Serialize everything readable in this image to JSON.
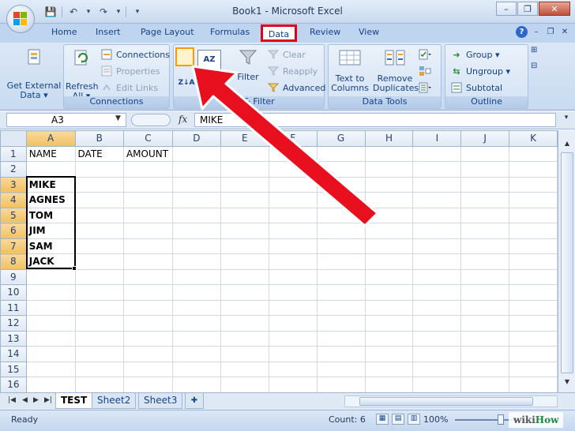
{
  "window": {
    "title": "Book1 - Microsoft Excel",
    "minimize": "–",
    "restore": "❐",
    "close": "✕"
  },
  "qat": {
    "save": "💾",
    "undo": "↶",
    "redo": "↷",
    "more": "▾"
  },
  "tabs": [
    {
      "label": "Home"
    },
    {
      "label": "Insert"
    },
    {
      "label": "Page Layout"
    },
    {
      "label": "Formulas"
    },
    {
      "label": "Data",
      "active": true
    },
    {
      "label": "Review"
    },
    {
      "label": "View"
    }
  ],
  "ribbon": {
    "get_external": {
      "line1": "Get External",
      "line2": "Data ▾"
    },
    "refresh": {
      "line1": "Refresh",
      "line2": "All ▾"
    },
    "connections": "Connections",
    "properties": "Properties",
    "edit_links": "Edit Links",
    "connections_group": "Connections",
    "sort_asc_icon": "A↓Z",
    "sort_desc_icon": "Z↓A",
    "sort_dialog_icon": "AZ",
    "filter": "Filter",
    "clear": "Clear",
    "reapply": "Reapply",
    "advanced": "Advanced",
    "sort_filter_group": "Sort & Filter",
    "text_to_columns": {
      "line1": "Text to",
      "line2": "Columns"
    },
    "remove_duplicates": {
      "line1": "Remove",
      "line2": "Duplicates"
    },
    "data_tools_group": "Data Tools",
    "group": "Group ▾",
    "ungroup": "Ungroup ▾",
    "subtotal": "Subtotal",
    "outline_group": "Outline"
  },
  "formula_bar": {
    "name_box": "A3",
    "fx": "fx",
    "value": "MIKE"
  },
  "grid": {
    "columns": [
      "A",
      "B",
      "C",
      "D",
      "E",
      "F",
      "G",
      "H",
      "I",
      "J",
      "K"
    ],
    "rows": [
      [
        "NAME",
        "DATE",
        "AMOUNT",
        "",
        "",
        "",
        "",
        "",
        "",
        "",
        ""
      ],
      [
        "",
        "",
        "",
        "",
        "",
        "",
        "",
        "",
        "",
        "",
        ""
      ],
      [
        "MIKE",
        "",
        "",
        "",
        "",
        "",
        "",
        "",
        "",
        "",
        ""
      ],
      [
        "AGNES",
        "",
        "",
        "",
        "",
        "",
        "",
        "",
        "",
        "",
        ""
      ],
      [
        "TOM",
        "",
        "",
        "",
        "",
        "",
        "",
        "",
        "",
        "",
        ""
      ],
      [
        "JIM",
        "",
        "",
        "",
        "",
        "",
        "",
        "",
        "",
        "",
        ""
      ],
      [
        "SAM",
        "",
        "",
        "",
        "",
        "",
        "",
        "",
        "",
        "",
        ""
      ],
      [
        "JACK",
        "",
        "",
        "",
        "",
        "",
        "",
        "",
        "",
        "",
        ""
      ],
      [
        "",
        "",
        "",
        "",
        "",
        "",
        "",
        "",
        "",
        "",
        ""
      ],
      [
        "",
        "",
        "",
        "",
        "",
        "",
        "",
        "",
        "",
        "",
        ""
      ],
      [
        "",
        "",
        "",
        "",
        "",
        "",
        "",
        "",
        "",
        "",
        ""
      ],
      [
        "",
        "",
        "",
        "",
        "",
        "",
        "",
        "",
        "",
        "",
        ""
      ],
      [
        "",
        "",
        "",
        "",
        "",
        "",
        "",
        "",
        "",
        "",
        ""
      ],
      [
        "",
        "",
        "",
        "",
        "",
        "",
        "",
        "",
        "",
        "",
        ""
      ],
      [
        "",
        "",
        "",
        "",
        "",
        "",
        "",
        "",
        "",
        "",
        ""
      ],
      [
        "",
        "",
        "",
        "",
        "",
        "",
        "",
        "",
        "",
        "",
        ""
      ]
    ],
    "selected_column": "A",
    "selected_rows": [
      3,
      4,
      5,
      6,
      7,
      8
    ]
  },
  "sheets": [
    {
      "label": "TEST",
      "active": true
    },
    {
      "label": "Sheet2"
    },
    {
      "label": "Sheet3"
    }
  ],
  "status": {
    "ready": "Ready",
    "count": "Count: 6",
    "zoom": "100%"
  },
  "watermark": {
    "prefix": "wiki",
    "suffix": "How"
  },
  "colors": {
    "highlight": "#e0001a",
    "arrow": "#e8101e",
    "selection": "#000000"
  }
}
